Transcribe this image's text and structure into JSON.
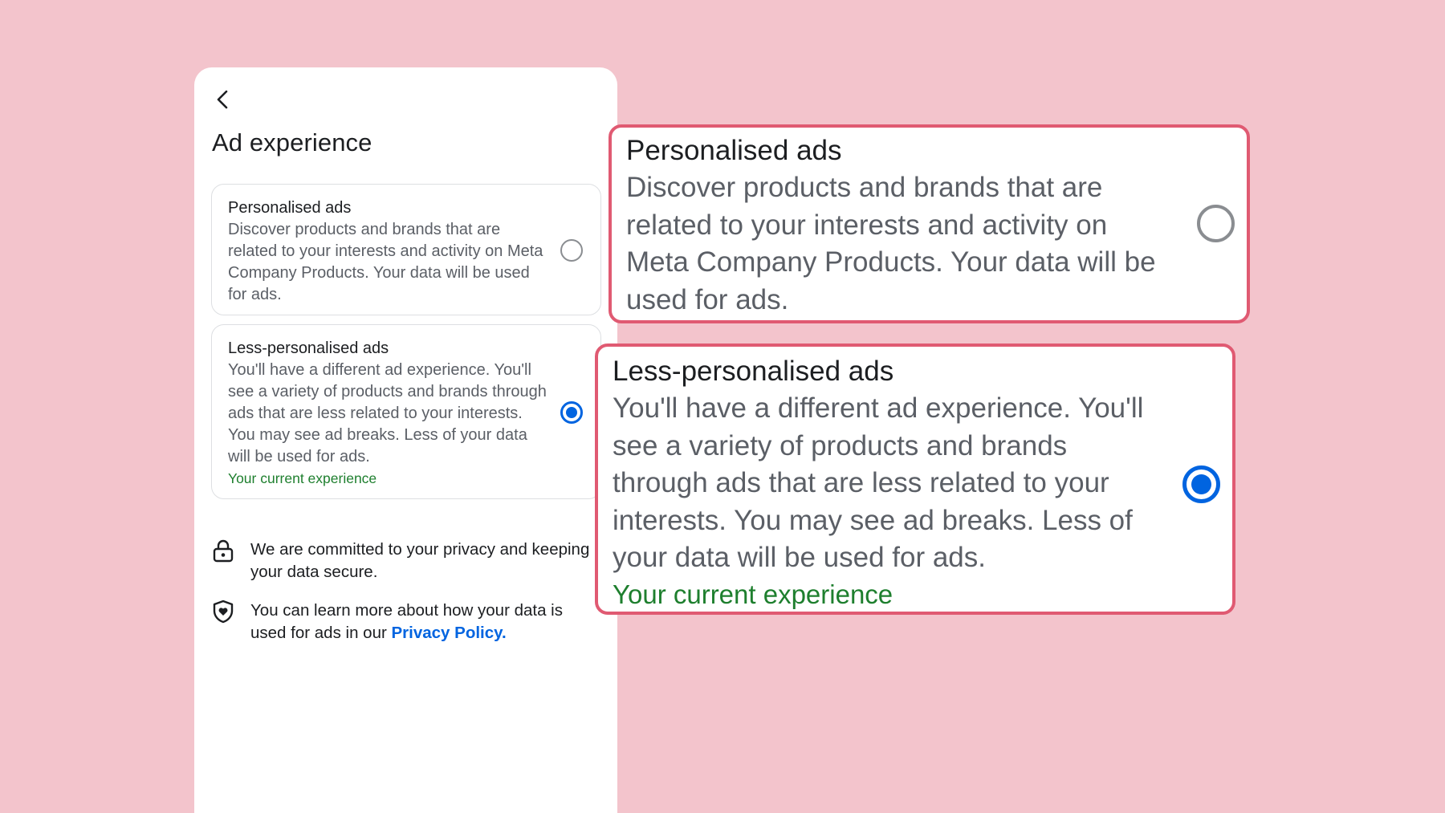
{
  "screen": {
    "title": "Ad experience",
    "back_icon": "chevron-left-icon"
  },
  "options": [
    {
      "id": "personalised",
      "label": "Personalised ads",
      "description": "Discover products and brands that are related to your interests and activity on Meta Company Products. Your data will be used for ads.",
      "selected": false
    },
    {
      "id": "less-personalised",
      "label": "Less-personalised ads",
      "description": "You'll have a different ad experience. You'll see a variety of products and brands through ads that are less related to your interests. You may see ad breaks. Less of your data will be used for ads.",
      "current_label": "Your current experience",
      "selected": true
    }
  ],
  "info": {
    "privacy_commitment": "We are committed to your privacy and keeping your data secure.",
    "learn_more_prefix": "You can learn more about how your data is used for ads in our ",
    "privacy_policy_link": "Privacy Policy."
  },
  "icons": {
    "lock": "lock-icon",
    "shield": "shield-heart-icon"
  },
  "colors": {
    "background": "#f3c4cc",
    "accent": "#0064e0",
    "current_experience": "#1e7f2e",
    "callout_border": "#e05a72"
  }
}
